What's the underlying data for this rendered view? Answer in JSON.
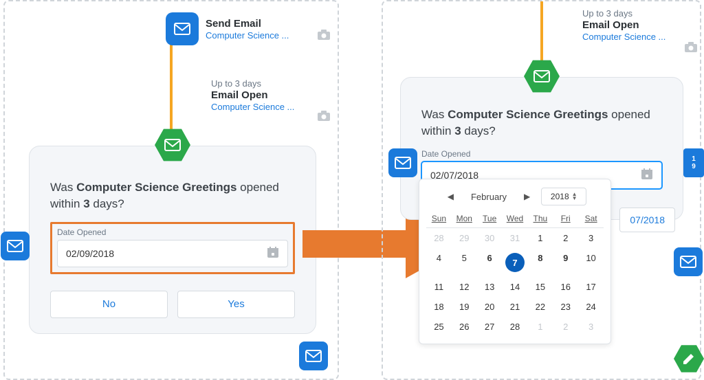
{
  "left": {
    "send_email": {
      "title": "Send Email",
      "link": "Computer Science ..."
    },
    "email_open": {
      "pretitle": "Up to 3 days",
      "title": "Email Open",
      "link": "Computer Science ..."
    },
    "card": {
      "prompt_pre": "Was ",
      "prompt_bold1": "Computer Science Greetings",
      "prompt_mid": " opened within ",
      "prompt_bold2": "3",
      "prompt_post": " days?",
      "field_label": "Date Opened",
      "date_value": "02/09/2018",
      "no": "No",
      "yes": "Yes"
    }
  },
  "right": {
    "email_open": {
      "pretitle": "Up to 3 days",
      "title": "Email Open",
      "link": "Computer Science ..."
    },
    "card": {
      "prompt_pre": "Was ",
      "prompt_bold1": "Computer Science Greetings",
      "prompt_mid": " opened within ",
      "prompt_bold2": "3",
      "prompt_post": " days?",
      "field_label": "Date Opened",
      "date_value": "02/07/2018"
    },
    "date_badge": "07/2018",
    "calendar": {
      "month": "February",
      "year": "2018",
      "dow": [
        "Sun",
        "Mon",
        "Tue",
        "Wed",
        "Thu",
        "Fri",
        "Sat"
      ],
      "days": [
        {
          "d": 28,
          "o": true
        },
        {
          "d": 29,
          "o": true
        },
        {
          "d": 30,
          "o": true
        },
        {
          "d": 31,
          "o": true
        },
        {
          "d": 1
        },
        {
          "d": 2
        },
        {
          "d": 3
        },
        {
          "d": 4
        },
        {
          "d": 5
        },
        {
          "d": 6,
          "b": true
        },
        {
          "d": 7,
          "s": true
        },
        {
          "d": 8,
          "b": true
        },
        {
          "d": 9,
          "b": true
        },
        {
          "d": 10
        },
        {
          "d": 11
        },
        {
          "d": 12
        },
        {
          "d": 13
        },
        {
          "d": 14
        },
        {
          "d": 15
        },
        {
          "d": 16
        },
        {
          "d": 17
        },
        {
          "d": 18
        },
        {
          "d": 19
        },
        {
          "d": 20
        },
        {
          "d": 21
        },
        {
          "d": 22
        },
        {
          "d": 23
        },
        {
          "d": 24
        },
        {
          "d": 25
        },
        {
          "d": 26
        },
        {
          "d": 27
        },
        {
          "d": 28
        },
        {
          "d": 1,
          "o": true
        },
        {
          "d": 2,
          "o": true
        },
        {
          "d": 3,
          "o": true
        }
      ]
    }
  }
}
